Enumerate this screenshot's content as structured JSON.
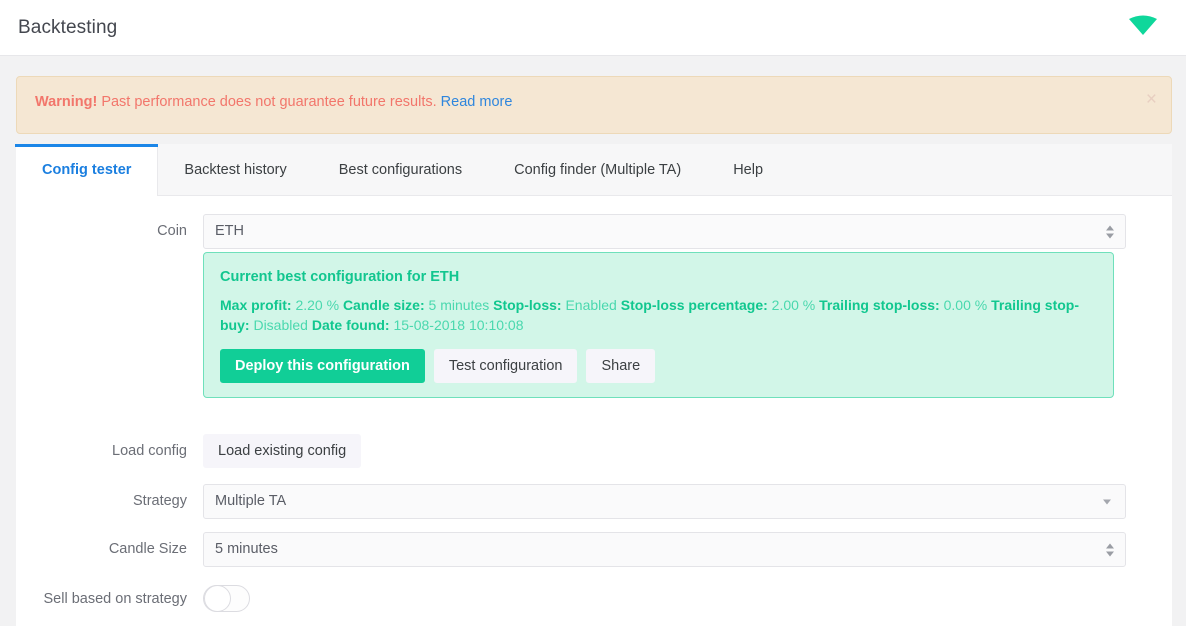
{
  "topbar": {
    "title": "Backtesting",
    "logo_icon": "gem-icon",
    "logo_color": "#0fd79b"
  },
  "alert": {
    "bold": "Warning!",
    "message": " Past performance does not guarantee future results. ",
    "link": "Read more",
    "close_label": "×",
    "bg_color": "#f5e7d3",
    "text_color": "#f2766b",
    "link_color": "#2f86dd"
  },
  "tabs": [
    {
      "label": "Config tester",
      "active": true
    },
    {
      "label": "Backtest history",
      "active": false
    },
    {
      "label": "Best configurations",
      "active": false
    },
    {
      "label": "Config finder (Multiple TA)",
      "active": false
    },
    {
      "label": "Help",
      "active": false
    }
  ],
  "accent_color": "#1b86e8",
  "form": {
    "coin": {
      "label": "Coin",
      "value": "ETH"
    },
    "best_config": {
      "title": "Current best configuration for ETH",
      "fields": [
        {
          "label": "Max profit:",
          "value": "2.20 %"
        },
        {
          "label": "Candle size:",
          "value": "5 minutes"
        },
        {
          "label": "Stop-loss:",
          "value": "Enabled"
        },
        {
          "label": "Stop-loss percentage:",
          "value": "2.00 %"
        },
        {
          "label": "Trailing stop-loss:",
          "value": "0.00 %"
        },
        {
          "label": "Trailing stop-buy:",
          "value": "Disabled"
        },
        {
          "label": "Date found:",
          "value": "15-08-2018 10:10:08"
        }
      ],
      "buttons": [
        {
          "label": "Deploy this configuration",
          "style": "primary"
        },
        {
          "label": "Test configuration",
          "style": "light"
        },
        {
          "label": "Share",
          "style": "light"
        }
      ],
      "bg_color": "#d2f6e8",
      "border_color": "#6fe0bb",
      "primary_color": "#11ce97"
    },
    "load_config": {
      "label": "Load config",
      "button": "Load existing config"
    },
    "strategy": {
      "label": "Strategy",
      "value": "Multiple TA"
    },
    "candle_size": {
      "label": "Candle Size",
      "value": "5 minutes"
    },
    "sell_based_on_strategy": {
      "label": "Sell based on strategy",
      "checked": false
    }
  }
}
